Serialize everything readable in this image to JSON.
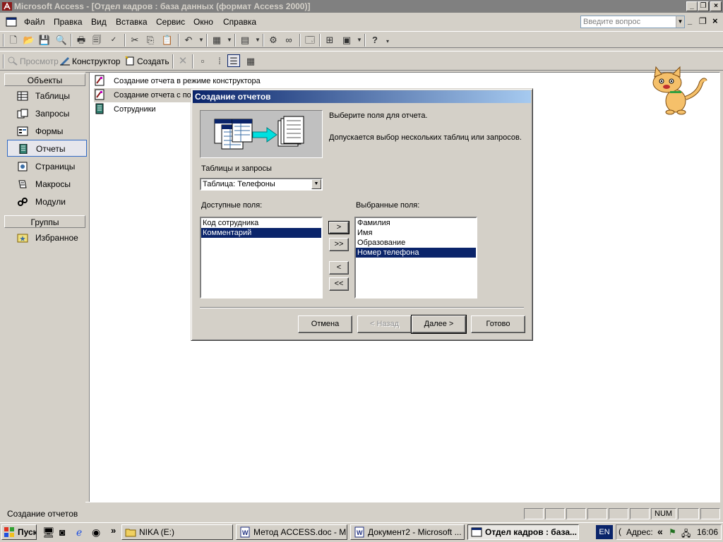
{
  "window": {
    "title": "Microsoft Access - [Отдел кадров : база данных (формат Access 2000)]"
  },
  "menu": {
    "items": [
      "Файл",
      "Правка",
      "Вид",
      "Вставка",
      "Сервис",
      "Окно",
      "Справка"
    ],
    "ask_placeholder": "Введите вопрос"
  },
  "db_toolbar": {
    "preview": "Просмотр",
    "designer": "Конструктор",
    "create": "Создать"
  },
  "objects_bar": {
    "header": "Объекты",
    "items": [
      "Таблицы",
      "Запросы",
      "Формы",
      "Отчеты",
      "Страницы",
      "Макросы",
      "Модули"
    ],
    "selected": "Отчеты",
    "groups_header": "Группы",
    "groups": [
      "Избранное"
    ]
  },
  "list": {
    "items": [
      "Создание отчета в режиме конструктора",
      "Создание отчета с по",
      "Сотрудники"
    ]
  },
  "wizard": {
    "title": "Создание отчетов",
    "prompt1": "Выберите поля для отчета.",
    "prompt2": "Допускается выбор нескольких таблиц или запросов.",
    "tables_label": "Таблицы и запросы",
    "table_value": "Таблица: Телефоны",
    "available_label": "Доступные поля:",
    "available_fields": [
      "Код сотрудника",
      "Комментарий"
    ],
    "available_selected": 1,
    "selected_label": "Выбранные поля:",
    "selected_fields": [
      "Фамилия",
      "Имя",
      "Образование",
      "Номер телефона"
    ],
    "selected_selected": 3,
    "move_one": ">",
    "move_all": ">>",
    "back_one": "<",
    "back_all": "<<",
    "cancel": "Отмена",
    "back": "< Назад",
    "next": "Далее >",
    "finish": "Готово"
  },
  "status": {
    "text": "Создание отчетов",
    "num": "NUM"
  },
  "taskbar": {
    "start": "Пуск",
    "tasks": [
      {
        "label": "NIKA (E:)",
        "active": false
      },
      {
        "label": "Метод ACCESS.doc - Mi...",
        "active": false
      },
      {
        "label": "Документ2 - Microsoft ...",
        "active": false
      },
      {
        "label": "Отдел кадров : база...",
        "active": true
      }
    ],
    "lang": "EN",
    "address": "Адрес:",
    "clock": "16:06"
  }
}
